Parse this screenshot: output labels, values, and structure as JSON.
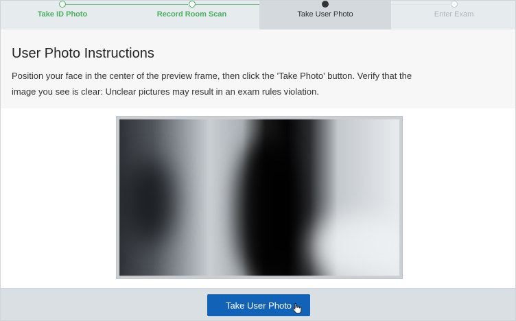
{
  "stepper": {
    "steps": [
      {
        "label": "Take ID Photo",
        "state": "done"
      },
      {
        "label": "Record Room Scan",
        "state": "done"
      },
      {
        "label": "Take User Photo",
        "state": "current"
      },
      {
        "label": "Enter Exam",
        "state": "future"
      }
    ]
  },
  "instructions": {
    "title": "User Photo Instructions",
    "body": "Position your face in the center of the preview frame, then click the 'Take Photo' button. Verify that the image you see is clear: Unclear pictures may result in an exam rules violation."
  },
  "footer": {
    "button_label": "Take User Photo"
  },
  "colors": {
    "accent": "#1262b8",
    "done": "#4caf61",
    "future": "#b0b6ba"
  },
  "icons": {
    "cursor": "hand-pointer-icon"
  }
}
